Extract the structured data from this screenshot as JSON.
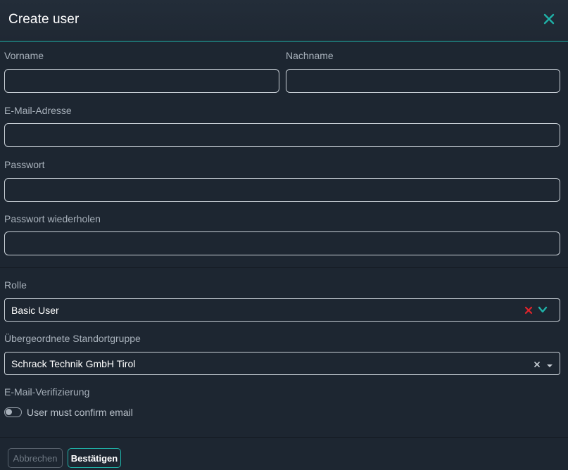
{
  "dialog": {
    "title": "Create user",
    "close_icon": "close-icon",
    "accent_color": "#1fb2a8",
    "background_color": "#1d2631"
  },
  "form": {
    "first_name": {
      "label": "Vorname",
      "value": ""
    },
    "last_name": {
      "label": "Nachname",
      "value": ""
    },
    "email": {
      "label": "E-Mail-Adresse",
      "value": ""
    },
    "password": {
      "label": "Passwort",
      "value": ""
    },
    "password_repeat": {
      "label": "Passwort wiederholen",
      "value": ""
    },
    "role": {
      "label": "Rolle",
      "selected": "Basic User",
      "clear_icon": "clear-x-icon",
      "dropdown_icon": "chevron-down-icon",
      "clear_color": "#e0242c"
    },
    "location_group": {
      "label": "Übergeordnete Standortgruppe",
      "selected": "Schrack Technik GmbH Tirol",
      "clear_icon": "clear-x-icon",
      "dropdown_icon": "caret-down-icon"
    },
    "email_verification": {
      "label": "E-Mail-Verifizierung",
      "toggle_label": "User must confirm email",
      "enabled": false
    }
  },
  "footer": {
    "cancel_label": "Abbrechen",
    "confirm_label": "Bestätigen"
  }
}
